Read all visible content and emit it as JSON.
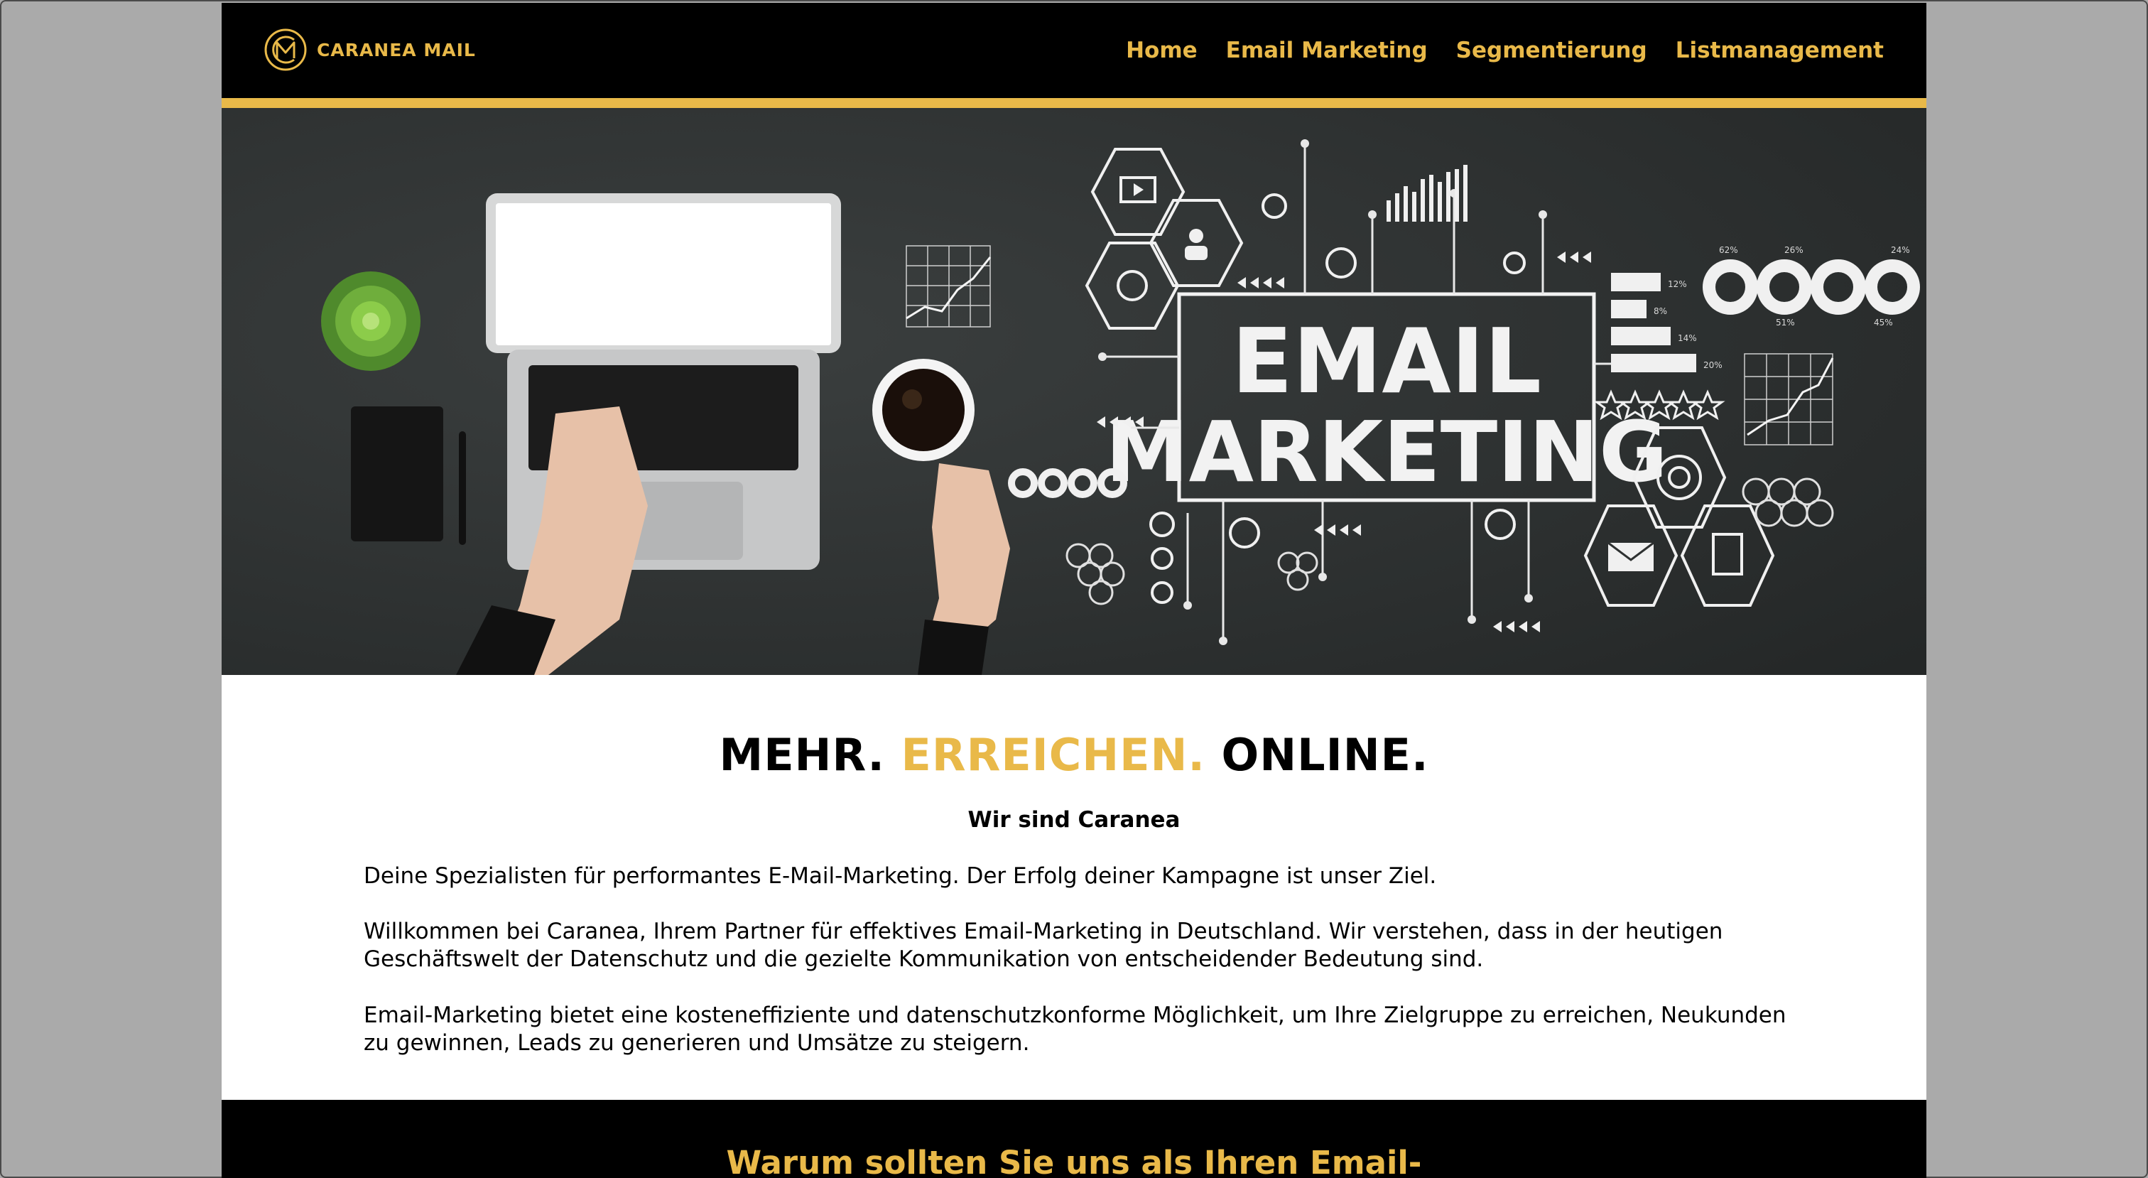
{
  "brand": {
    "name": "CARANEA MAIL",
    "accent_color": "#e9b949",
    "logo_icon": "cm-monogram-logo"
  },
  "nav": {
    "items": [
      {
        "label": "Home"
      },
      {
        "label": "Email Marketing"
      },
      {
        "label": "Segmentierung"
      },
      {
        "label": "Listmanagement"
      }
    ]
  },
  "hero": {
    "image_text_line1": "EMAIL",
    "image_text_line2": "MARKETING",
    "percent_labels": [
      "62%",
      "26%",
      "24%",
      "51%",
      "45%",
      "12%",
      "8%",
      "14%",
      "20%"
    ]
  },
  "intro": {
    "headline_part1": "MEHR.",
    "headline_part2": "ERREICHEN.",
    "headline_part3": "ONLINE.",
    "subheading": "Wir sind Caranea",
    "paragraph1": "Deine Spezialisten für performantes E-Mail-Marketing. Der Erfolg deiner Kampagne ist unser Ziel.",
    "paragraph2": "Willkommen bei Caranea, Ihrem Partner für effektives Email-Marketing in Deutschland. Wir verstehen, dass in der heutigen Geschäftswelt der Datenschutz und die gezielte Kommunikation von entscheidender Bedeutung sind.",
    "paragraph3": "Email-Marketing bietet eine kosteneffiziente und datenschutzkonforme Möglichkeit, um Ihre Zielgruppe zu erreichen, Neukunden zu gewinnen, Leads zu generieren und Umsätze zu steigern."
  },
  "why": {
    "title": "Warum sollten Sie uns als Ihren Email-"
  },
  "colors": {
    "header_bg": "#000000",
    "hero_bg": "#2e3131",
    "page_bg": "#aaaaaa"
  }
}
